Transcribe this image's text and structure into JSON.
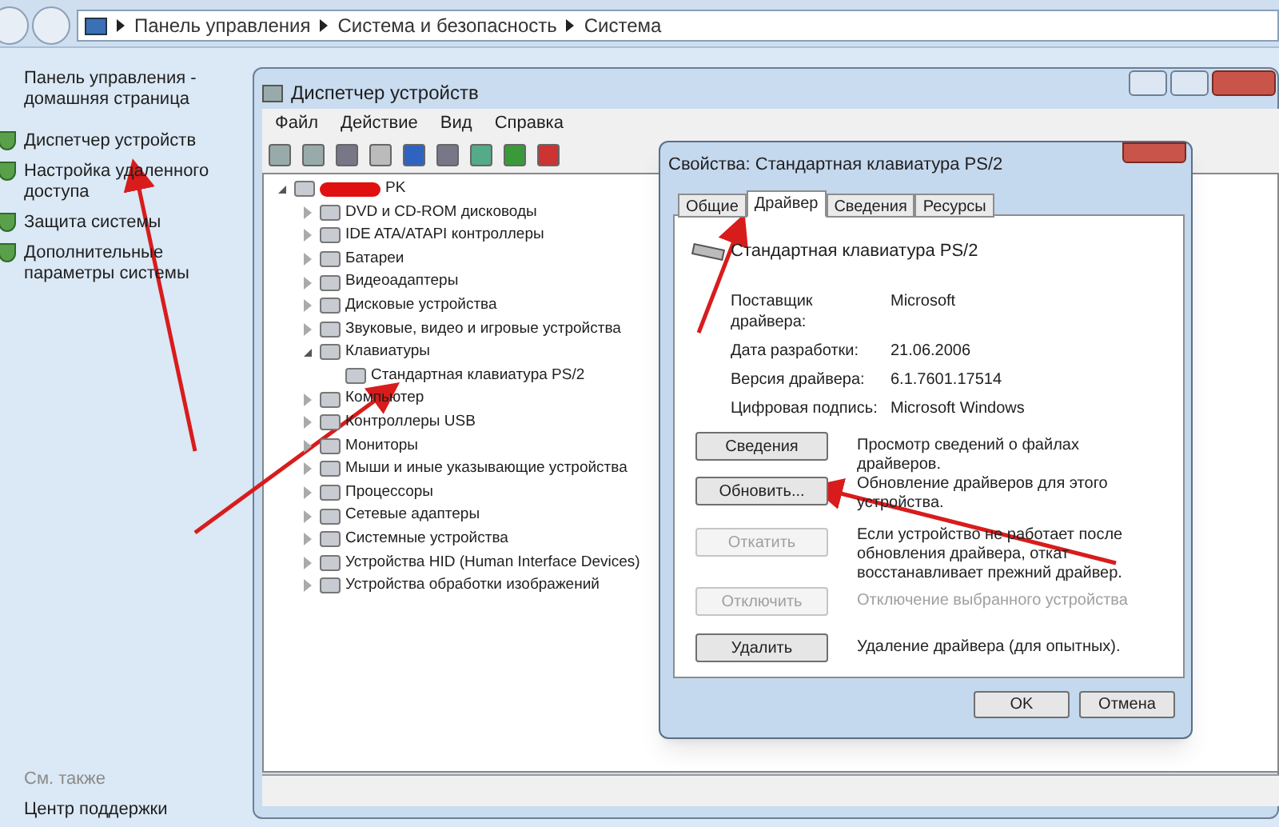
{
  "address_bar": {
    "breadcrumb": [
      "Панель управления",
      "Система и безопасность",
      "Система"
    ]
  },
  "left_pane": {
    "home_link": "Панель управления - домашняя страница",
    "links": [
      {
        "label": "Диспетчер устройств"
      },
      {
        "label": "Настройка удаленного доступа"
      },
      {
        "label": "Защита системы"
      },
      {
        "label": "Дополнительные параметры системы"
      }
    ],
    "see_also": "См. также",
    "support_link": "Центр поддержки"
  },
  "device_manager": {
    "title": "Диспетчер устройств",
    "menu": [
      "Файл",
      "Действие",
      "Вид",
      "Справка"
    ],
    "tree": {
      "label": "PK",
      "redacted": true,
      "expanded": true,
      "children": [
        {
          "label": "DVD и CD-ROM дисководы",
          "expanded": false
        },
        {
          "label": "IDE ATA/ATAPI контроллеры",
          "expanded": false
        },
        {
          "label": "Батареи",
          "expanded": false
        },
        {
          "label": "Видеоадаптеры",
          "expanded": false
        },
        {
          "label": "Дисковые устройства",
          "expanded": false
        },
        {
          "label": "Звуковые, видео и игровые устройства",
          "expanded": false
        },
        {
          "label": "Клавиатуры",
          "expanded": true,
          "children": [
            {
              "label": "Стандартная клавиатура PS/2"
            }
          ]
        },
        {
          "label": "Компьютер",
          "expanded": false
        },
        {
          "label": "Контроллеры USB",
          "expanded": false
        },
        {
          "label": "Мониторы",
          "expanded": false
        },
        {
          "label": "Мыши и иные указывающие устройства",
          "expanded": false
        },
        {
          "label": "Процессоры",
          "expanded": false
        },
        {
          "label": "Сетевые адаптеры",
          "expanded": false
        },
        {
          "label": "Системные устройства",
          "expanded": false
        },
        {
          "label": "Устройства HID (Human Interface Devices)",
          "expanded": false
        },
        {
          "label": "Устройства обработки изображений",
          "expanded": false
        }
      ]
    }
  },
  "properties_dialog": {
    "title": "Свойства: Стандартная клавиатура PS/2",
    "tabs": [
      {
        "label": "Общие",
        "selected": false
      },
      {
        "label": "Драйвер",
        "selected": true
      },
      {
        "label": "Сведения",
        "selected": false
      },
      {
        "label": "Ресурсы",
        "selected": false
      }
    ],
    "device_name": "Стандартная клавиатура PS/2",
    "info": [
      {
        "label": "Поставщик драйвера:",
        "value": "Microsoft"
      },
      {
        "label": "Дата разработки:",
        "value": "21.06.2006"
      },
      {
        "label": "Версия драйвера:",
        "value": "6.1.7601.17514"
      },
      {
        "label": "Цифровая подпись:",
        "value": "Microsoft Windows"
      }
    ],
    "actions": [
      {
        "button": "Сведения",
        "description": "Просмотр сведений о файлах драйверов.",
        "disabled": false
      },
      {
        "button": "Обновить...",
        "description": "Обновление драйверов для этого устройства.",
        "disabled": false
      },
      {
        "button": "Откатить",
        "description": "Если устройство не работает после обновления драйвера, откат восстанавливает прежний драйвер.",
        "disabled": true
      },
      {
        "button": "Отключить",
        "description": "Отключение выбранного устройства",
        "disabled": true
      },
      {
        "button": "Удалить",
        "description": "Удаление драйвера (для опытных).",
        "disabled": false
      }
    ],
    "buttons": [
      "OK",
      "Отмена"
    ]
  }
}
